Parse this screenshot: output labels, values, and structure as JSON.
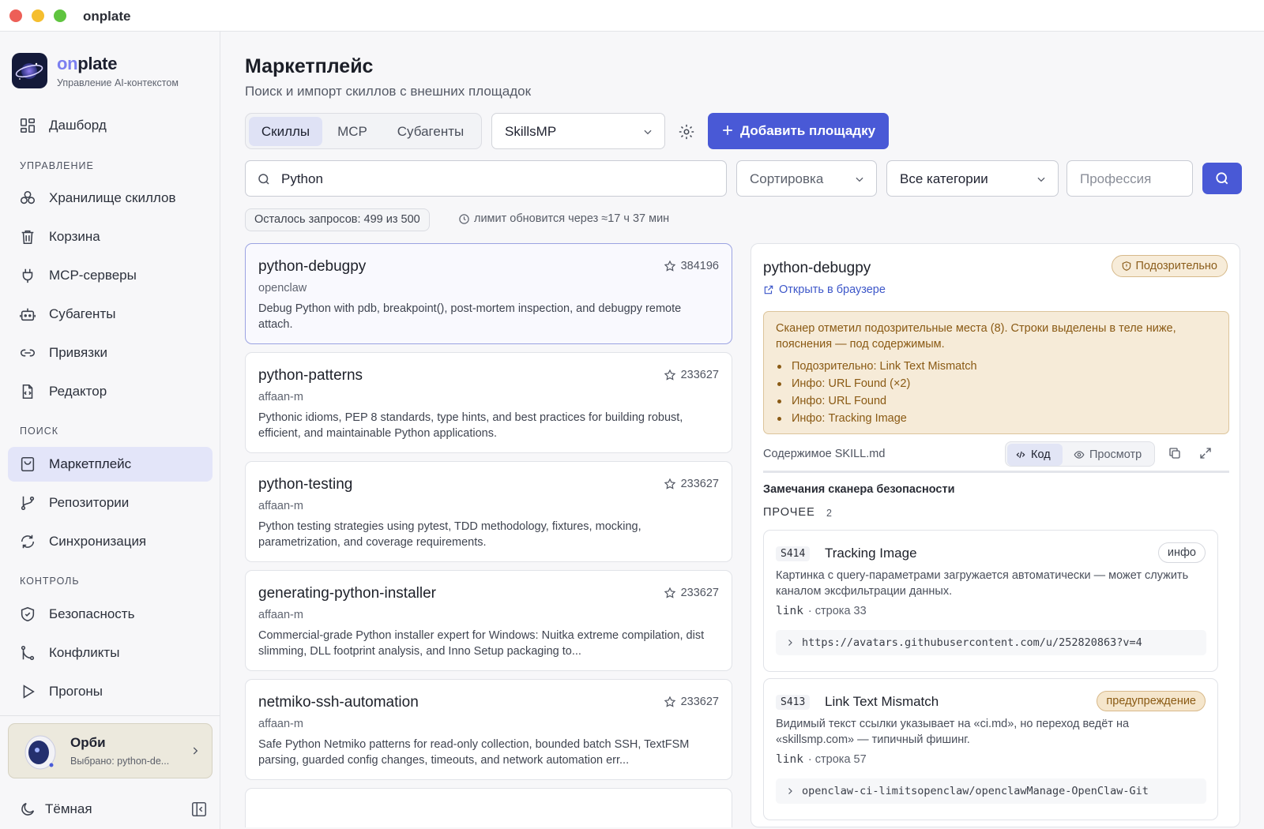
{
  "window": {
    "title": "onplate",
    "colors": {
      "close": "#ed5f57",
      "minimize": "#f5be2e",
      "zoom": "#5fc43f"
    }
  },
  "brand": {
    "name_accent": "on",
    "name_rest": "plate",
    "subtitle": "Управление AI-контекстом"
  },
  "sidebar": {
    "top_item": {
      "label": "Дашборд",
      "icon": "dashboard-icon"
    },
    "sections": [
      {
        "label": "УПРАВЛЕНИЕ",
        "items": [
          {
            "label": "Хранилище скиллов",
            "icon": "skills-storage-icon"
          },
          {
            "label": "Корзина",
            "icon": "trash-icon"
          },
          {
            "label": "MCP-серверы",
            "icon": "plug-icon"
          },
          {
            "label": "Субагенты",
            "icon": "bot-icon"
          },
          {
            "label": "Привязки",
            "icon": "link-icon"
          },
          {
            "label": "Редактор",
            "icon": "file-code-icon"
          }
        ]
      },
      {
        "label": "ПОИСК",
        "items": [
          {
            "label": "Маркетплейс",
            "icon": "store-icon",
            "active": true
          },
          {
            "label": "Репозитории",
            "icon": "git-branch-icon"
          },
          {
            "label": "Синхронизация",
            "icon": "sync-icon"
          }
        ]
      },
      {
        "label": "КОНТРОЛЬ",
        "items": [
          {
            "label": "Безопасность",
            "icon": "shield-check-icon"
          },
          {
            "label": "Конфликты",
            "icon": "git-merge-icon"
          },
          {
            "label": "Прогоны",
            "icon": "play-icon"
          }
        ]
      }
    ],
    "orbi": {
      "name": "Орби",
      "subtitle": "Выбрано: python-de..."
    },
    "theme_label": "Тёмная"
  },
  "main": {
    "title": "Маркетплейс",
    "subtitle": "Поиск и импорт скиллов с внешних площадок",
    "tabs": [
      {
        "label": "Скиллы",
        "active": true
      },
      {
        "label": "MCP",
        "active": false
      },
      {
        "label": "Субагенты",
        "active": false
      }
    ],
    "source_select": "SkillsMP",
    "add_button": "Добавить площадку",
    "search": {
      "value": "Python"
    },
    "sort_select": "Сортировка",
    "category_select": "Все категории",
    "profession": {
      "placeholder": "Профессия"
    },
    "quota": "Осталось запросов: 499 из 500",
    "limit": "лимит обновится через ≈17 ч 37 мин",
    "accent_color": "#4959d6"
  },
  "results": [
    {
      "name": "python-debugpy",
      "author": "openclaw",
      "stars": "384196",
      "desc": "Debug Python with pdb, breakpoint(), post-mortem inspection, and debugpy remote attach.",
      "selected": true
    },
    {
      "name": "python-patterns",
      "author": "affaan-m",
      "stars": "233627",
      "desc": "Pythonic idioms, PEP 8 standards, type hints, and best practices for building robust, efficient, and maintainable Python applications."
    },
    {
      "name": "python-testing",
      "author": "affaan-m",
      "stars": "233627",
      "desc": "Python testing strategies using pytest, TDD methodology, fixtures, mocking, parametrization, and coverage requirements."
    },
    {
      "name": "generating-python-installer",
      "author": "affaan-m",
      "stars": "233627",
      "desc": "Commercial-grade Python installer expert for Windows: Nuitka extreme compilation, dist slimming, DLL footprint analysis, and Inno Setup packaging to..."
    },
    {
      "name": "netmiko-ssh-automation",
      "author": "affaan-m",
      "stars": "233627",
      "desc": "Safe Python Netmiko patterns for read-only collection, bounded batch SSH, TextFSM parsing, guarded config changes, timeouts, and network automation err..."
    }
  ],
  "detail": {
    "title": "python-debugpy",
    "open_link": "Открыть в браузере",
    "status_badge": "Подозрительно",
    "warning": {
      "text": "Сканер отметил подозрительные места (8). Строки выделены в теле ниже, пояснения — под содержимым.",
      "items": [
        "Подозрительно: Link Text Mismatch",
        "Инфо: URL Found (×2)",
        "Инфо: URL Found",
        "Инфо: Tracking Image"
      ]
    },
    "content_label": "Содержимое SKILL.md",
    "view_code": "Код",
    "view_preview": "Просмотр",
    "scanner_title": "Замечания сканера безопасности",
    "section_label": "ПРОЧЕЕ",
    "section_count": "2",
    "findings": [
      {
        "code": "S414",
        "title": "Tracking Image",
        "severity": "инфо",
        "desc": "Картинка с query-параметрами загружается автоматически — может служить каналом эксфильтрации данных.",
        "loc_kind": "link",
        "loc_line": "· строка 33",
        "snippet": "https://avatars.githubusercontent.com/u/252820863?v=4"
      },
      {
        "code": "S413",
        "title": "Link Text Mismatch",
        "severity": "предупреждение",
        "desc": "Видимый текст ссылки указывает на «ci.md», но переход ведёт на «skillsmp.com» — типичный фишинг.",
        "loc_kind": "link",
        "loc_line": "· строка 57",
        "snippet": "openclaw-ci-limitsopenclaw/openclawManage-OpenClaw-Git"
      }
    ]
  }
}
